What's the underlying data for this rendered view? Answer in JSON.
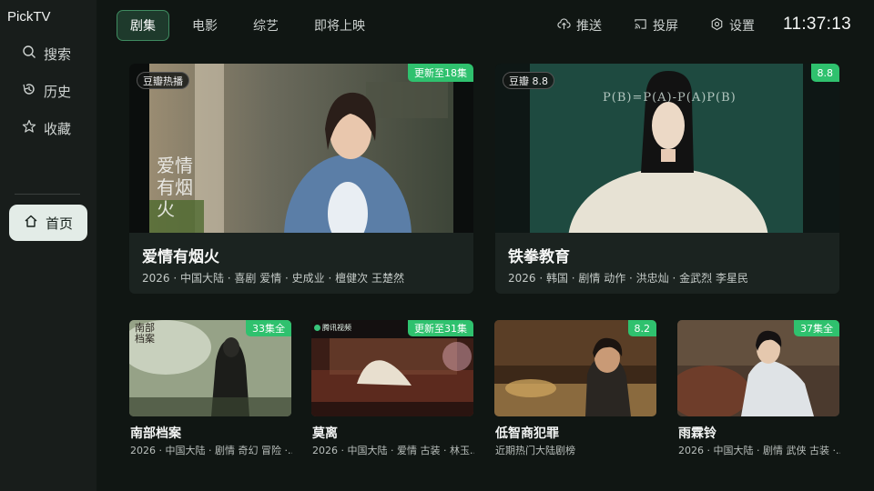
{
  "app": {
    "title": "PickTV"
  },
  "sidebar": {
    "items": [
      {
        "label": "搜索",
        "icon": "search-icon"
      },
      {
        "label": "历史",
        "icon": "history-icon"
      },
      {
        "label": "收藏",
        "icon": "star-icon"
      }
    ],
    "home": {
      "label": "首页",
      "icon": "home-icon"
    }
  },
  "tabs": [
    {
      "label": "剧集",
      "active": true
    },
    {
      "label": "电影",
      "active": false
    },
    {
      "label": "综艺",
      "active": false
    },
    {
      "label": "即将上映",
      "active": false
    }
  ],
  "top_actions": [
    {
      "label": "推送",
      "icon": "upload-cloud-icon"
    },
    {
      "label": "投屏",
      "icon": "cast-icon"
    },
    {
      "label": "设置",
      "icon": "gear-icon"
    }
  ],
  "clock": "11:37:13",
  "featured": [
    {
      "title": "爱情有烟火",
      "meta": "2026 · 中国大陆 · 喜剧 爱情 · 史成业 · 檀健次 王楚然",
      "badge_left": "豆瓣热播",
      "badge_right": "更新至18集",
      "poster_text": "爱情有烟火"
    },
    {
      "title": "铁拳教育",
      "meta": "2026 · 韩国 · 剧情 动作 · 洪忠灿 · 金武烈 李星民",
      "badge_left": "豆瓣 8.8",
      "badge_right": "8.8",
      "poster_text": "P(B)=P(A)-P(A)P(B)"
    }
  ],
  "cards": [
    {
      "title": "南部档案",
      "meta": "2026 · 中国大陆 · 剧情 奇幻 冒险 ·...",
      "badge_right": "33集全",
      "poster_text": "南部档案"
    },
    {
      "title": "莫离",
      "meta": "2026 · 中国大陆 · 爱情 古装 · 林玉...",
      "badge_right": "更新至31集",
      "badge_left": "腾讯视频"
    },
    {
      "title": "低智商犯罪",
      "meta": "近期热门大陆剧榜",
      "badge_right": "8.2"
    },
    {
      "title": "雨霖铃",
      "meta": "2026 · 中国大陆 · 剧情 武侠 古装 ·...",
      "badge_right": "37集全"
    }
  ],
  "colors": {
    "accent": "#2fc16e",
    "background": "#101613",
    "sidebar": "#181d1b",
    "home_pill": "#e3ece7"
  }
}
